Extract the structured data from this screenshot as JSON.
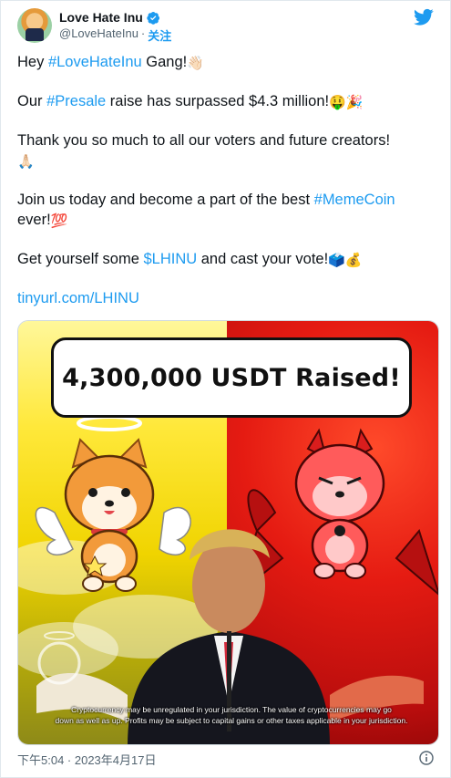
{
  "user": {
    "name": "Love Hate Inu",
    "handle": "@LoveHateInu",
    "separator": "·",
    "follow_label": "关注"
  },
  "tweet": {
    "line1_pre": "Hey ",
    "line1_tag": "#LoveHateInu",
    "line1_post": " Gang!",
    "line1_emoji": "👋🏻",
    "line2_pre": "Our ",
    "line2_tag": "#Presale",
    "line2_post": " raise has surpassed $4.3 million!",
    "line2_emoji": "🤑🎉",
    "line3": "Thank you so much to all our voters and future creators!",
    "line3_emoji": "🙏🏻",
    "line4_pre": "Join us today and become a part of the best ",
    "line4_tag": "#MemeCoin",
    "line4_post": " ever!",
    "line4_emoji": "💯",
    "line5_pre": "Get yourself some ",
    "line5_tag": "$LHINU",
    "line5_post": " and cast your vote!",
    "line5_emoji": "🗳️💰",
    "link": "tinyurl.com/LHINU"
  },
  "media": {
    "headline": "4,300,000 USDT Raised!",
    "disclaimer_line1": "Cryptocurrency may be unregulated in your jurisdiction. The value of cryptocurrencies may go",
    "disclaimer_line2": "down as well as up. Profits may be subject to capital gains or other taxes applicable in your jurisdiction."
  },
  "footer": {
    "timestamp": "下午5:04 · 2023年4月17日"
  },
  "colors": {
    "link": "#1d9bf0",
    "text": "#0f1419",
    "muted": "#536471"
  },
  "icons": {
    "verified": "verified-badge-icon",
    "twitter": "twitter-bird-icon",
    "info": "info-icon"
  }
}
